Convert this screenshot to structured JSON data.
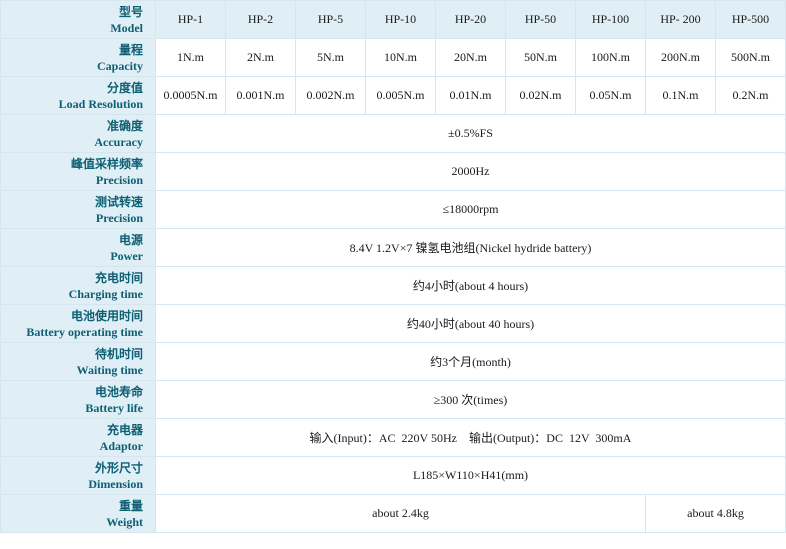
{
  "rows": [
    {
      "zh": "型号",
      "en": "Model",
      "values": [
        "HP-1",
        "HP-2",
        "HP-5",
        "HP-10",
        "HP-20",
        "HP-50",
        "HP-100",
        "HP- 200",
        "HP-500"
      ]
    },
    {
      "zh": "量程",
      "en": "Capacity",
      "values": [
        "1N.m",
        "2N.m",
        "5N.m",
        "10N.m",
        "20N.m",
        "50N.m",
        "100N.m",
        "200N.m",
        "500N.m"
      ]
    },
    {
      "zh": "分度值",
      "en": "Load Resolution",
      "values": [
        "0.0005N.m",
        "0.001N.m",
        "0.002N.m",
        "0.005N.m",
        "0.01N.m",
        "0.02N.m",
        "0.05N.m",
        "0.1N.m",
        "0.2N.m"
      ]
    },
    {
      "zh": "准确度",
      "en": "Accuracy",
      "value": "±0.5%FS"
    },
    {
      "zh": "峰值采样频率",
      "en": "Precision",
      "value": "2000Hz"
    },
    {
      "zh": "测试转速",
      "en": "Precision",
      "value": "≤18000rpm"
    },
    {
      "zh": "电源",
      "en": "Power",
      "value": "8.4V  1.2V×7 镍氢电池组(Nickel hydride battery)"
    },
    {
      "zh": "充电时间",
      "en": "Charging time",
      "value": "约4小时(about 4 hours)"
    },
    {
      "zh": "电池使用时间",
      "en": "Battery operating time",
      "value": "约40小时(about 40 hours)"
    },
    {
      "zh": "待机时间",
      "en": "Waiting time",
      "value": "约3个月(month)"
    },
    {
      "zh": "电池寿命",
      "en": "Battery life",
      "value": "≥300 次(times)"
    },
    {
      "zh": "充电器",
      "en": "Adaptor",
      "value": "输入(Input)：AC  220V 50Hz    输出(Output)：DC  12V  300mA"
    },
    {
      "zh": "外形尺寸",
      "en": "Dimension",
      "value": "L185×W110×H41(mm)"
    },
    {
      "zh": "重量",
      "en": "Weight",
      "values": [
        "about 2.4kg",
        "about 4.8kg"
      ]
    }
  ]
}
